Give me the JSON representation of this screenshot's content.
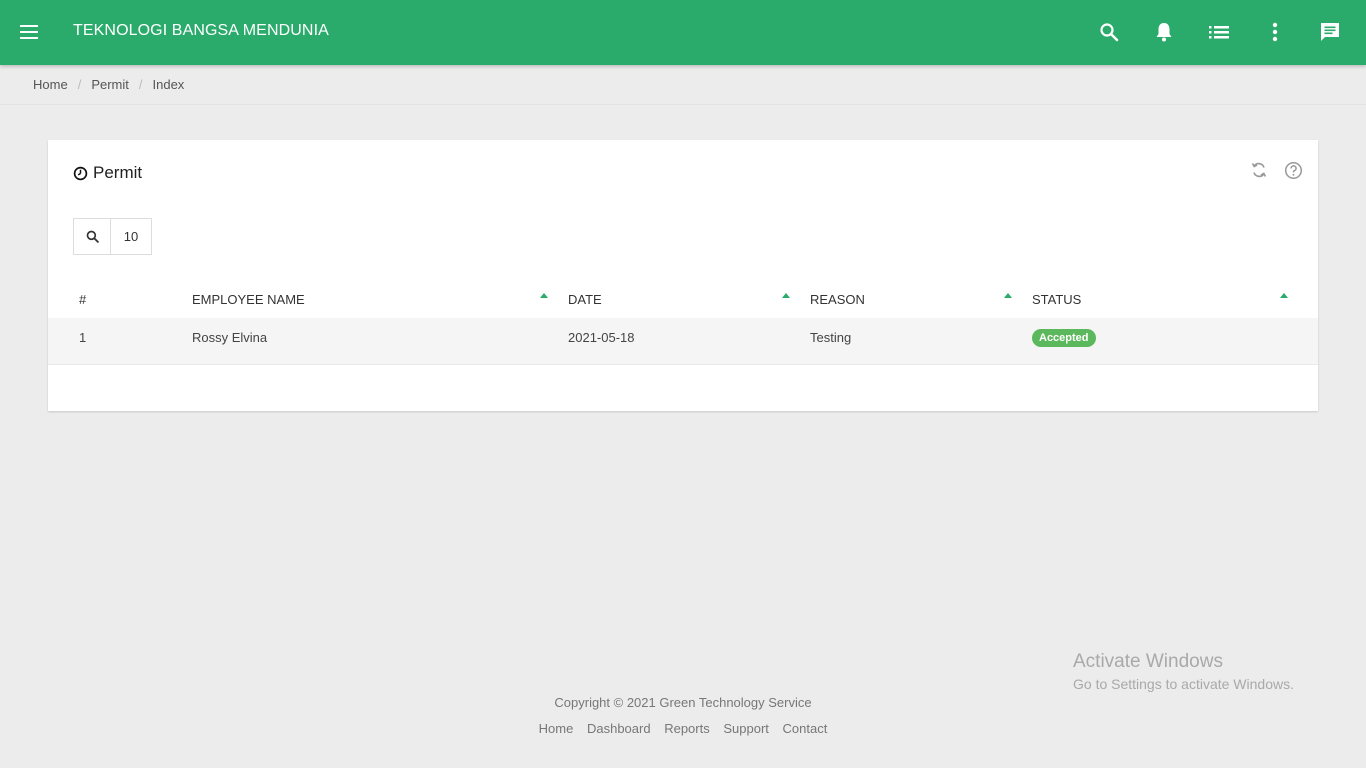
{
  "app": {
    "brand": "TEKNOLOGI BANGSA MENDUNIA",
    "accent_color": "#2aab6b",
    "header_icons": [
      "search-icon",
      "bell-icon",
      "list-icon",
      "more-vert-icon",
      "chat-icon"
    ]
  },
  "breadcrumb": {
    "items": [
      "Home",
      "Permit",
      "Index"
    ],
    "separator": "/"
  },
  "card": {
    "title": "Permit",
    "title_icon": "clock-icon",
    "tools": [
      "refresh-icon",
      "help-icon"
    ],
    "page_size": "10"
  },
  "table": {
    "columns": [
      "#",
      "EMPLOYEE NAME",
      "DATE",
      "REASON",
      "STATUS"
    ],
    "rows": [
      {
        "no": "1",
        "employee_name": "Rossy Elvina",
        "date": "2021-05-18",
        "reason": "Testing",
        "status": "Accepted",
        "status_color": "#5cb85c"
      }
    ]
  },
  "footer": {
    "copyright": "Copyright © 2021 Green Technology Service",
    "links": [
      "Home",
      "Dashboard",
      "Reports",
      "Support",
      "Contact"
    ]
  },
  "watermark": {
    "title": "Activate Windows",
    "subtitle": "Go to Settings to activate Windows."
  }
}
